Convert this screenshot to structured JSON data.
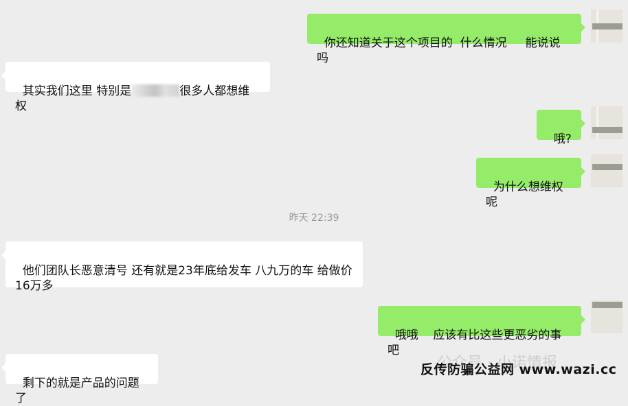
{
  "messages": [
    {
      "side": "right",
      "text": "你还知道关于这个项目的  什么情况     能说说吗"
    },
    {
      "side": "left",
      "text_before": "其实我们这里 特别是",
      "text_after": "很多人都想维权"
    },
    {
      "side": "right",
      "text": "哦?"
    },
    {
      "side": "right",
      "text": "为什么想维权呢"
    },
    {
      "side": "left",
      "text": "他们团队长恶意清号 还有就是23年底给发车 八九万的车 给做价16万多"
    },
    {
      "side": "right",
      "text": "哦哦    应该有比这些更恶劣的事吧"
    },
    {
      "side": "left",
      "text": "剩下的就是产品的问题了"
    }
  ],
  "timestamp": "昨天 22:39",
  "watermark": {
    "faint": "公众号 · 小诺情报",
    "strong": "反传防骗公益网 www.wazi.cc"
  },
  "colors": {
    "background": "#ededed",
    "sent_bubble": "#95ec69",
    "received_bubble": "#ffffff"
  }
}
